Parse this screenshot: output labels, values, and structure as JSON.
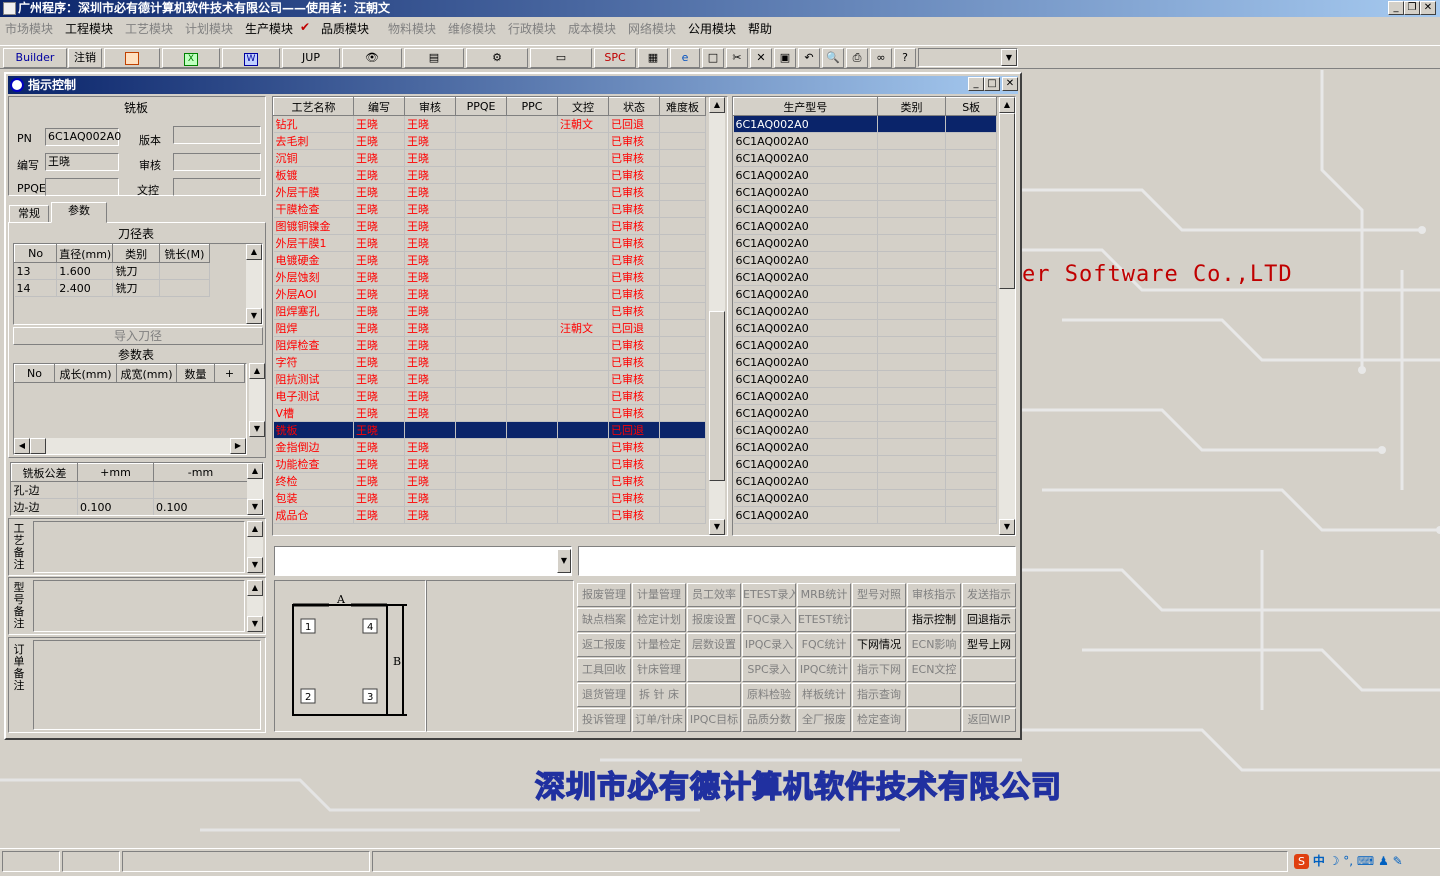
{
  "app": {
    "title": "广州程序：深圳市必有德计算机软件技术有限公司——使用者：汪朝文"
  },
  "menu": [
    {
      "label": "市场模块",
      "enabled": false
    },
    {
      "label": "工程模块",
      "enabled": true
    },
    {
      "label": "工艺模块",
      "enabled": false
    },
    {
      "label": "计划模块",
      "enabled": false
    },
    {
      "label": "生产模块",
      "enabled": true
    },
    {
      "label": "品质模块",
      "enabled": true
    },
    {
      "label": "物料模块",
      "enabled": false
    },
    {
      "label": "维修模块",
      "enabled": false
    },
    {
      "label": "行政模块",
      "enabled": false
    },
    {
      "label": "成本模块",
      "enabled": false
    },
    {
      "label": "网络模块",
      "enabled": false
    },
    {
      "label": "公用模块",
      "enabled": true
    },
    {
      "label": "帮助",
      "enabled": true
    }
  ],
  "toolbar": {
    "builder": "Builder",
    "logout": "注销",
    "jup": "JUP",
    "spc": "SPC"
  },
  "window": {
    "title": "指示控制"
  },
  "left": {
    "section_title": "铣板",
    "pn_label": "PN",
    "pn_value": "6C1AQ002A0",
    "version_label": "版本",
    "version_value": "",
    "author_label": "编写",
    "author_value": "王晓",
    "review_label": "审核",
    "review_value": "",
    "ppqe_label": "PPQE",
    "ppqe_value": "",
    "doc_label": "文控",
    "doc_value": "",
    "tabs": [
      "常规",
      "参数"
    ],
    "tool_table_title": "刀径表",
    "tool_headers": [
      "No",
      "直径(mm)",
      "类别",
      "铣长(M)"
    ],
    "tool_rows": [
      [
        "13",
        "1.600",
        "铣刀",
        ""
      ],
      [
        "14",
        "2.400",
        "铣刀",
        ""
      ]
    ],
    "import_button": "导入刀径",
    "param_table_title": "参数表",
    "param_headers": [
      "No",
      "成长(mm)",
      "成宽(mm)",
      "数量",
      "+"
    ],
    "tol_headers": [
      "铣板公差",
      "+mm",
      "-mm"
    ],
    "tol_rows": [
      [
        "孔-边",
        "",
        ""
      ],
      [
        "边-边",
        "0.100",
        "0.100"
      ]
    ],
    "note_labels": [
      "工艺备注",
      "型号备注",
      "订单备注"
    ]
  },
  "process": {
    "headers": [
      "工艺名称",
      "编写",
      "审核",
      "PPQE",
      "PPC",
      "文控",
      "状态",
      "难度板"
    ],
    "rows": [
      [
        "钻孔",
        "王晓",
        "王晓",
        "",
        "",
        "汪朝文",
        "已回退",
        ""
      ],
      [
        "去毛刺",
        "王晓",
        "王晓",
        "",
        "",
        "",
        "已审核",
        ""
      ],
      [
        "沉铜",
        "王晓",
        "王晓",
        "",
        "",
        "",
        "已审核",
        ""
      ],
      [
        "板镀",
        "王晓",
        "王晓",
        "",
        "",
        "",
        "已审核",
        ""
      ],
      [
        "外层干膜",
        "王晓",
        "王晓",
        "",
        "",
        "",
        "已审核",
        ""
      ],
      [
        "干膜检查",
        "王晓",
        "王晓",
        "",
        "",
        "",
        "已审核",
        ""
      ],
      [
        "图镀铜镍金",
        "王晓",
        "王晓",
        "",
        "",
        "",
        "已审核",
        ""
      ],
      [
        "外层干膜1",
        "王晓",
        "王晓",
        "",
        "",
        "",
        "已审核",
        ""
      ],
      [
        "电镀硬金",
        "王晓",
        "王晓",
        "",
        "",
        "",
        "已审核",
        ""
      ],
      [
        "外层蚀刻",
        "王晓",
        "王晓",
        "",
        "",
        "",
        "已审核",
        ""
      ],
      [
        "外层AOI",
        "王晓",
        "王晓",
        "",
        "",
        "",
        "已审核",
        ""
      ],
      [
        "阻焊塞孔",
        "王晓",
        "王晓",
        "",
        "",
        "",
        "已审核",
        ""
      ],
      [
        "阻焊",
        "王晓",
        "王晓",
        "",
        "",
        "汪朝文",
        "已回退",
        ""
      ],
      [
        "阻焊检查",
        "王晓",
        "王晓",
        "",
        "",
        "",
        "已审核",
        ""
      ],
      [
        "字符",
        "王晓",
        "王晓",
        "",
        "",
        "",
        "已审核",
        ""
      ],
      [
        "阻抗测试",
        "王晓",
        "王晓",
        "",
        "",
        "",
        "已审核",
        ""
      ],
      [
        "电子测试",
        "王晓",
        "王晓",
        "",
        "",
        "",
        "已审核",
        ""
      ],
      [
        "V槽",
        "王晓",
        "王晓",
        "",
        "",
        "",
        "已审核",
        ""
      ],
      [
        "铣板",
        "王晓",
        "",
        "",
        "",
        "",
        "已回退",
        ""
      ],
      [
        "金指倒边",
        "王晓",
        "王晓",
        "",
        "",
        "",
        "已审核",
        ""
      ],
      [
        "功能检查",
        "王晓",
        "王晓",
        "",
        "",
        "",
        "已审核",
        ""
      ],
      [
        "终检",
        "王晓",
        "王晓",
        "",
        "",
        "",
        "已审核",
        ""
      ],
      [
        "包装",
        "王晓",
        "王晓",
        "",
        "",
        "",
        "已审核",
        ""
      ],
      [
        "成品仓",
        "王晓",
        "王晓",
        "",
        "",
        "",
        "已审核",
        ""
      ]
    ],
    "selected_index": 18
  },
  "models": {
    "headers": [
      "生产型号",
      "类别",
      "S板"
    ],
    "rows": [
      "6C1AQ002A0",
      "6C1AQ002A0",
      "6C1AQ002A0",
      "6C1AQ002A0",
      "6C1AQ002A0",
      "6C1AQ002A0",
      "6C1AQ002A0",
      "6C1AQ002A0",
      "6C1AQ002A0",
      "6C1AQ002A0",
      "6C1AQ002A0",
      "6C1AQ002A0",
      "6C1AQ002A0",
      "6C1AQ002A0",
      "6C1AQ002A0",
      "6C1AQ002A0",
      "6C1AQ002A0",
      "6C1AQ002A0",
      "6C1AQ002A0",
      "6C1AQ002A0",
      "6C1AQ002A0",
      "6C1AQ002A0",
      "6C1AQ002A0",
      "6C1AQ002A0"
    ]
  },
  "diagram": {
    "a": "A",
    "b": "B",
    "corners": [
      "1",
      "4",
      "2",
      "3"
    ]
  },
  "buttons": [
    [
      {
        "l": "报废管理",
        "e": false
      },
      {
        "l": "计量管理",
        "e": false
      },
      {
        "l": "员工效率",
        "e": false
      },
      {
        "l": "ETEST录入",
        "e": false
      },
      {
        "l": "MRB统计",
        "e": false
      },
      {
        "l": "型号对照",
        "e": false
      },
      {
        "l": "审核指示",
        "e": false
      },
      {
        "l": "发送指示",
        "e": false
      }
    ],
    [
      {
        "l": "缺点档案",
        "e": false
      },
      {
        "l": "检定计划",
        "e": false
      },
      {
        "l": "报废设置",
        "e": false
      },
      {
        "l": "FQC录入",
        "e": false
      },
      {
        "l": "ETEST统计",
        "e": false
      },
      {
        "l": "",
        "e": false
      },
      {
        "l": "指示控制",
        "e": true
      },
      {
        "l": "回退指示",
        "e": true
      }
    ],
    [
      {
        "l": "返工报废",
        "e": false
      },
      {
        "l": "计量检定",
        "e": false
      },
      {
        "l": "层数设置",
        "e": false
      },
      {
        "l": "IPQC录入",
        "e": false
      },
      {
        "l": "FQC统计",
        "e": false
      },
      {
        "l": "下网情况",
        "e": true
      },
      {
        "l": "ECN影响",
        "e": false
      },
      {
        "l": "型号上网",
        "e": true
      }
    ],
    [
      {
        "l": "工具回收",
        "e": false
      },
      {
        "l": "针床管理",
        "e": false
      },
      {
        "l": "",
        "e": false
      },
      {
        "l": "SPC录入",
        "e": false
      },
      {
        "l": "IPQC统计",
        "e": false
      },
      {
        "l": "指示下网",
        "e": false
      },
      {
        "l": "ECN文控",
        "e": false
      },
      {
        "l": "",
        "e": false
      }
    ],
    [
      {
        "l": "退货管理",
        "e": false
      },
      {
        "l": "拆 针 床",
        "e": false
      },
      {
        "l": "",
        "e": false
      },
      {
        "l": "原料检验",
        "e": false
      },
      {
        "l": "样板统计",
        "e": false
      },
      {
        "l": "指示查询",
        "e": false
      },
      {
        "l": "",
        "e": false
      },
      {
        "l": "",
        "e": false
      }
    ],
    [
      {
        "l": "投诉管理",
        "e": false
      },
      {
        "l": "订单/针床",
        "e": false
      },
      {
        "l": "IPQC目标",
        "e": false
      },
      {
        "l": "品质分数",
        "e": false
      },
      {
        "l": "全厂报废",
        "e": false
      },
      {
        "l": "检定查询",
        "e": false
      },
      {
        "l": "",
        "e": false
      },
      {
        "l": "返回WIP",
        "e": false
      }
    ]
  ],
  "desktop": {
    "brand": "er Software Co.,LTD",
    "company": "深圳市必有德计算机软件技术有限公司"
  },
  "tray": {
    "ime": "中"
  }
}
